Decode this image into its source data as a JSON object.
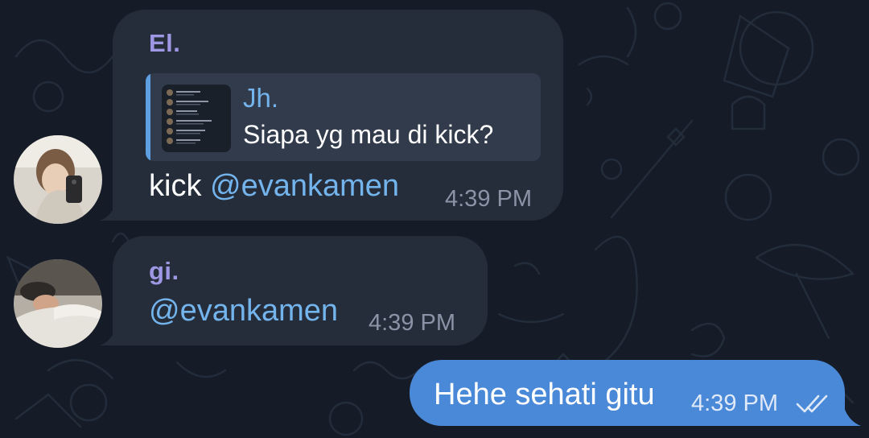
{
  "chat": {
    "messages": [
      {
        "sender": "El.",
        "reply_name": "Jh.",
        "reply_text": "Siapa yg mau di kick?",
        "text_prefix": "kick ",
        "mention": "@evankamen",
        "time": "4:39 PM"
      },
      {
        "sender": "gi.",
        "mention": "@evankamen",
        "time": "4:39 PM"
      },
      {
        "text": "Hehe sehati gitu",
        "time": "4:39 PM",
        "status_icon": "double-check-icon"
      }
    ]
  },
  "colors": {
    "background": "#151c27",
    "incoming_bubble": "#252d3b",
    "outgoing_bubble": "#4a88d8",
    "sender_name": "#9e97e3",
    "mention": "#74b4ec"
  }
}
